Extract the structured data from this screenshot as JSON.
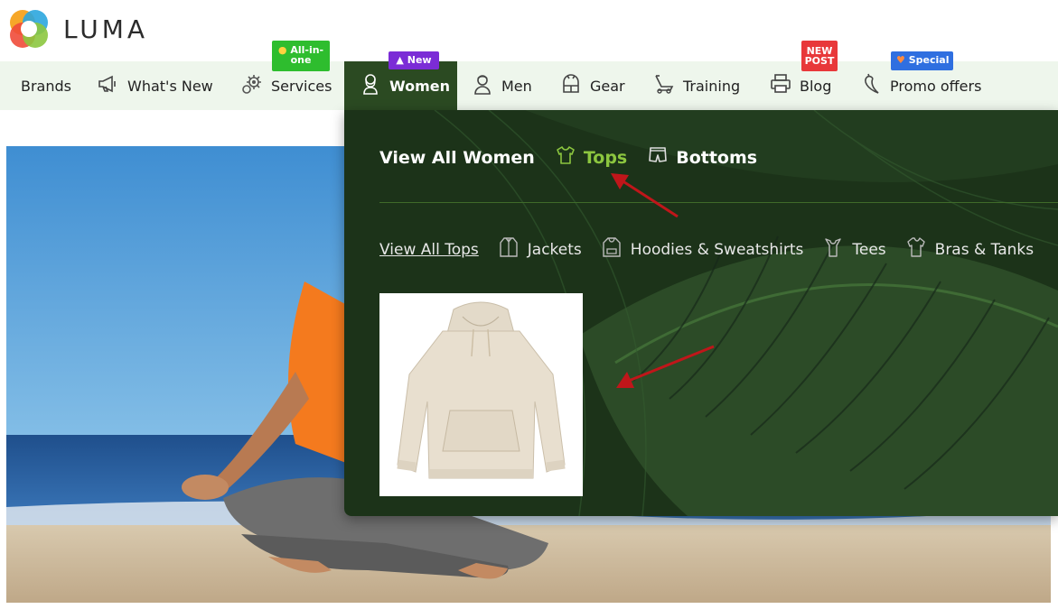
{
  "logo": {
    "text": "LUMA"
  },
  "nav": {
    "items": [
      {
        "label": "Brands",
        "icon": "none"
      },
      {
        "label": "What's New",
        "icon": "megaphone-icon"
      },
      {
        "label": "Services",
        "icon": "gear-icon"
      },
      {
        "label": "Women",
        "icon": "woman-icon",
        "active": true
      },
      {
        "label": "Men",
        "icon": "man-icon"
      },
      {
        "label": "Gear",
        "icon": "bag-icon"
      },
      {
        "label": "Training",
        "icon": "treadmill-icon"
      },
      {
        "label": "Blog",
        "icon": "printer-icon"
      },
      {
        "label": "Promo offers",
        "icon": "pepper-icon"
      }
    ],
    "badges": {
      "services": {
        "text": "All-in-one",
        "line1": "All-in-",
        "line2": "one",
        "color": "#2ebd2e",
        "icon": "fire-icon"
      },
      "women": {
        "text": "New",
        "color": "#7b2cd6",
        "icon": "rocket-icon"
      },
      "blog": {
        "text": "NEW POST",
        "line1": "NEW",
        "line2": "POST",
        "color": "#e8383a"
      },
      "promo": {
        "text": "Special",
        "color": "#2f6fe0",
        "icon": "heart-icon"
      }
    }
  },
  "mega_menu": {
    "categories": [
      {
        "label": "View All Women",
        "icon": "none"
      },
      {
        "label": "Tops",
        "icon": "shirt-icon",
        "active": true
      },
      {
        "label": "Bottoms",
        "icon": "shorts-icon"
      }
    ],
    "subcategories": [
      {
        "label": "View All Tops",
        "icon": "none"
      },
      {
        "label": "Jackets",
        "icon": "jacket-icon"
      },
      {
        "label": "Hoodies & Sweatshirts",
        "icon": "hoodie-icon"
      },
      {
        "label": "Tees",
        "icon": "tee-icon"
      },
      {
        "label": "Bras & Tanks",
        "icon": "tank-icon"
      }
    ],
    "product": {
      "image": "beige-hoodie"
    }
  },
  "colors": {
    "nav_bg": "#eef6ec",
    "nav_active": "#2b4a22",
    "accent_green": "#8cc63f",
    "mega_bg": "#1f3a1c",
    "arrow_red": "#c0161a"
  }
}
